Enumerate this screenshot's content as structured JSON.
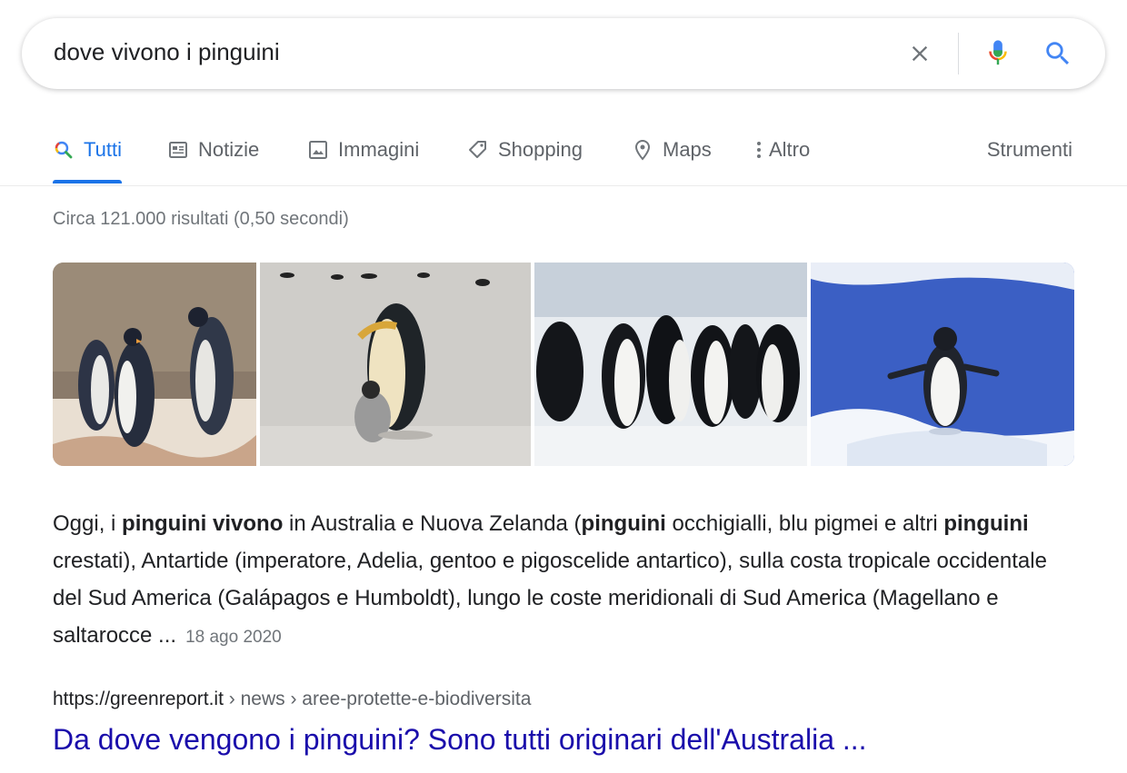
{
  "search": {
    "query": "dove vivono i pinguini"
  },
  "tabs": [
    {
      "label": "Tutti",
      "icon": "search-multicolor-icon",
      "active": true
    },
    {
      "label": "Notizie",
      "icon": "newspaper-icon"
    },
    {
      "label": "Immagini",
      "icon": "image-icon"
    },
    {
      "label": "Shopping",
      "icon": "tag-icon"
    },
    {
      "label": "Maps",
      "icon": "map-pin-icon"
    },
    {
      "label": "Altro",
      "icon": "more-vertical-icon"
    }
  ],
  "tools_label": "Strumenti",
  "stats": "Circa 121.000 risultati (0,50 secondi)",
  "images": [
    {
      "subject": "king-penguins-group"
    },
    {
      "subject": "emperor-penguin-with-chick"
    },
    {
      "subject": "adelie-penguins-on-snow"
    },
    {
      "subject": "penguin-on-blue-ice"
    }
  ],
  "snippet": {
    "t1": "Oggi, i ",
    "b1": "pinguini vivono",
    "t2": " in Australia e Nuova Zelanda (",
    "b2": "pinguini",
    "t3": " occhigialli, blu pigmei e altri ",
    "b3": "pinguini",
    "t4": " crestati), Antartide (imperatore, Adelia, gentoo e pigoscelide antartico), sulla costa tropicale occidentale del Sud America (Galápagos e Humboldt), lungo le coste meridionali di Sud America (Magellano e saltarocce ...",
    "date": "18 ago 2020"
  },
  "result": {
    "url_host": "https://greenreport.it",
    "url_path": " › news › aree-protette-e-biodiversita",
    "title": "Da dove vengono i pinguini? Sono tutti originari dell'Australia ..."
  },
  "colors": {
    "link_blue": "#1a0dab",
    "tab_active": "#1a73e8",
    "muted": "#70757a"
  }
}
